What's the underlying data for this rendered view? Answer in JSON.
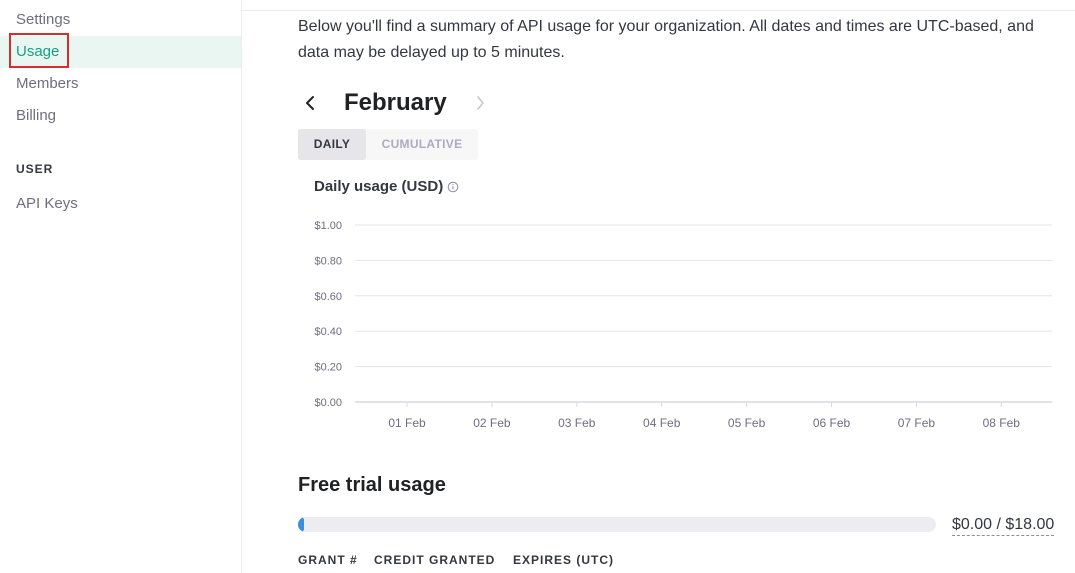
{
  "sidebar": {
    "items": [
      {
        "label": "Settings"
      },
      {
        "label": "Usage",
        "active": true
      },
      {
        "label": "Members"
      },
      {
        "label": "Billing"
      }
    ],
    "user_heading": "USER",
    "user_items": [
      {
        "label": "API Keys"
      }
    ]
  },
  "main": {
    "intro": "Below you'll find a summary of API usage for your organization. All dates and times are UTC-based, and data may be delayed up to 5 minutes.",
    "month": "February",
    "prev_icon": "chevron-left-icon",
    "next_icon": "chevron-right-icon",
    "tabs": [
      {
        "label": "DAILY",
        "selected": true
      },
      {
        "label": "CUMULATIVE",
        "selected": false
      }
    ],
    "chart_title": "Daily usage (USD)",
    "info_icon": "info-icon",
    "free_trial": {
      "title": "Free trial usage",
      "amount": "$0.00 / $18.00",
      "progress_fraction": 0.0,
      "columns": [
        "GRANT #",
        "CREDIT GRANTED",
        "EXPIRES (UTC)"
      ]
    }
  },
  "colors": {
    "accent": "#10a37f",
    "progress": "#3b8fd6",
    "highlight": "#d32f2f"
  },
  "chart_data": {
    "type": "bar",
    "title": "Daily usage (USD)",
    "categories": [
      "01 Feb",
      "02 Feb",
      "03 Feb",
      "04 Feb",
      "05 Feb",
      "06 Feb",
      "07 Feb",
      "08 Feb"
    ],
    "values": [
      0,
      0,
      0,
      0,
      0,
      0,
      0,
      0
    ],
    "y_ticks": [
      "$0.00",
      "$0.20",
      "$0.40",
      "$0.60",
      "$0.80",
      "$1.00"
    ],
    "ylim": [
      0,
      1
    ],
    "grid": true
  }
}
